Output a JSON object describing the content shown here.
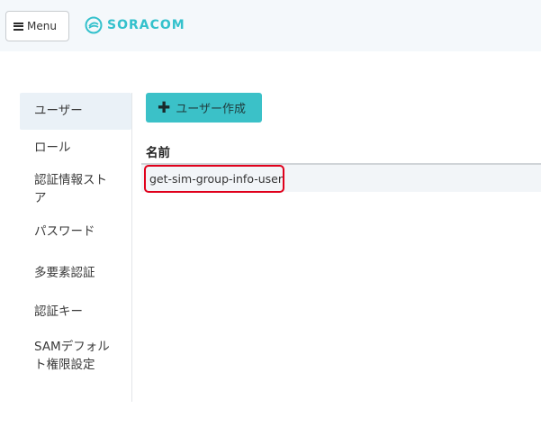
{
  "header": {
    "menu_label": "Menu",
    "brand": "SORACOM",
    "brand_color": "#34c1cc"
  },
  "sidebar": {
    "items": [
      {
        "label": "ユーザー",
        "active": true
      },
      {
        "label": "ロール"
      },
      {
        "label_lines": [
          "認証情報スト",
          "ア"
        ]
      },
      {
        "label": "パスワード"
      },
      {
        "label": "多要素認証"
      },
      {
        "label": "認証キー"
      },
      {
        "label_lines": [
          "SAMデフォル",
          "ト権限設定"
        ]
      }
    ]
  },
  "main": {
    "create_button_label": "ユーザー作成",
    "accent_color": "#3bc1c8",
    "table": {
      "columns": [
        "名前"
      ],
      "rows": [
        {
          "name": "get-sim-group-info-user"
        }
      ]
    }
  }
}
